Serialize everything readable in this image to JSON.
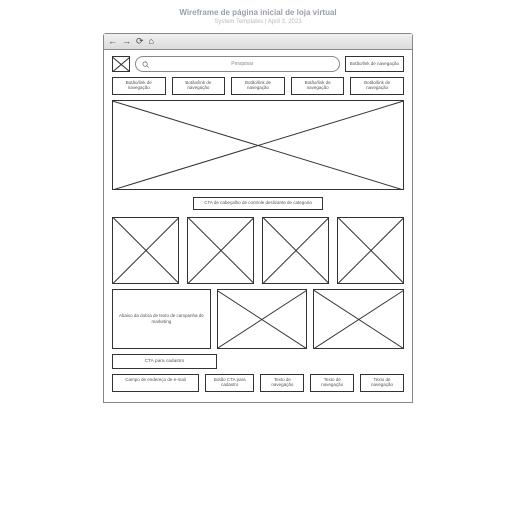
{
  "meta": {
    "title": "Wireframe de página inicial de loja virtual",
    "subtitle": "System Templates | April 3, 2023"
  },
  "browser": {
    "back_icon": "←",
    "forward_icon": "→",
    "reload_icon": "⟳",
    "home_icon": "⌂"
  },
  "top": {
    "search_placeholder": "Pesquisar",
    "nav_button_right": "Botão/link de navegação"
  },
  "nav_row": [
    "Botão/link de navegação",
    "Botão/link de navegação",
    "Botão/link de navegação",
    "Botão/link de navegação",
    "Botão/link de navegação"
  ],
  "cta_bar": "CTA de cabeçalho de controle deslizante de categoria",
  "text_block": "Abaixo da dobra de texto de campanha de marketing",
  "signup": {
    "cta_wide": "CTA para cadastro",
    "email_field": "Campo de endereço de e-mail",
    "signup_btn": "Botão CTA para cadastro",
    "footer_nav": [
      "Texto de navegação",
      "Texto de navegação",
      "Texto de navegação"
    ]
  }
}
